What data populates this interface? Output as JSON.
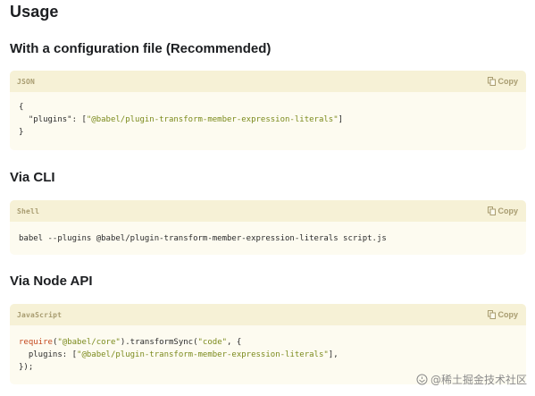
{
  "page_title": "Usage",
  "sections": [
    {
      "heading": "With a configuration file (Recommended)",
      "lang": "JSON",
      "copy_label": "Copy",
      "code": {
        "l1": "{",
        "l2_key": "  \"plugins\": [",
        "l2_str": "\"@babel/plugin-transform-member-expression-literals\"",
        "l2_end": "]",
        "l3": "}"
      }
    },
    {
      "heading": "Via CLI",
      "lang": "Shell",
      "copy_label": "Copy",
      "code": {
        "l1": "babel --plugins @babel/plugin-transform-member-expression-literals script.js"
      }
    },
    {
      "heading": "Via Node API",
      "lang": "JavaScript",
      "copy_label": "Copy",
      "code": {
        "l1_fn": "require",
        "l1_p1": "(",
        "l1_s1": "\"@babel/core\"",
        "l1_p2": ").transformSync(",
        "l1_s2": "\"code\"",
        "l1_p3": ", {",
        "l2_key": "  plugins: [",
        "l2_str": "\"@babel/plugin-transform-member-expression-literals\"",
        "l2_end": "],",
        "l3": "});"
      }
    }
  ],
  "watermark": "@稀土掘金技术社区",
  "colors": {
    "header_bg": "#f6f1d6",
    "block_bg": "#fdfbf0",
    "string": "#7b8a1c",
    "function": "#c54a1f"
  }
}
